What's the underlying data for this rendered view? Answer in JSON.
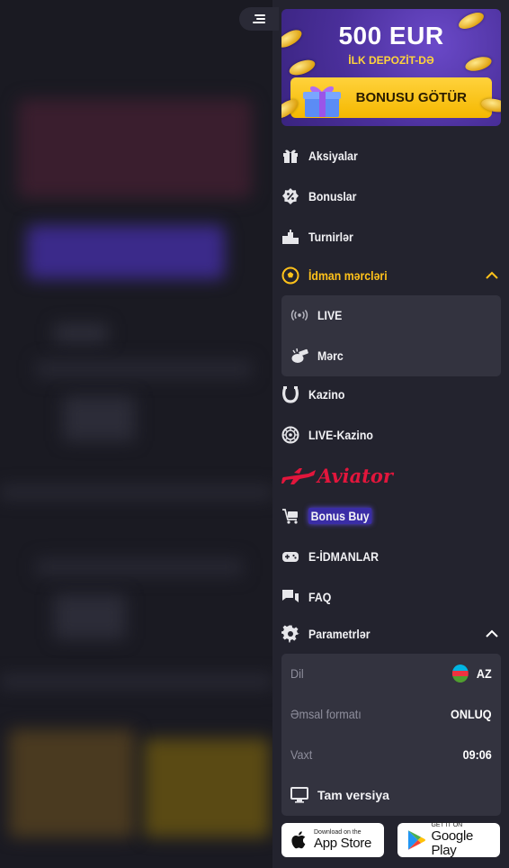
{
  "promo": {
    "amount": "500 EUR",
    "subtitle": "İLK DEPOZİT-DƏ",
    "button_label": "BONUSU GÖTÜR"
  },
  "menu": {
    "items": [
      {
        "label": "Aksiyalar",
        "icon": "gift-icon"
      },
      {
        "label": "Bonuslar",
        "icon": "percent-badge-icon"
      },
      {
        "label": "Turnirlər",
        "icon": "podium-icon"
      },
      {
        "label": "İdman mərcləri",
        "icon": "football-icon",
        "active": true,
        "expanded": true
      }
    ],
    "sport_sub": [
      {
        "label": "LIVE",
        "icon": "live-broadcast-icon"
      },
      {
        "label": "Mərc",
        "icon": "whistle-icon"
      }
    ],
    "items2": [
      {
        "label": "Kazino",
        "icon": "horseshoe-icon"
      },
      {
        "label": "LIVE-Kazino",
        "icon": "roulette-icon"
      }
    ],
    "aviator_label": "Aviator",
    "items3": [
      {
        "label": "Bonus Buy",
        "icon": "cart-icon"
      },
      {
        "label": "E-İDMANLAR",
        "icon": "gamepad-icon"
      },
      {
        "label": "FAQ",
        "icon": "chat-icon"
      },
      {
        "label": "Parametrlər",
        "icon": "gear-icon",
        "expanded": true
      }
    ]
  },
  "settings": {
    "language_key": "Dil",
    "language_value": "AZ",
    "odds_key": "Əmsal formatı",
    "odds_value": "ONLUQ",
    "time_key": "Vaxt",
    "time_value": "09:06",
    "full_version_label": "Tam versiya"
  },
  "stores": {
    "apple_small": "Download on the",
    "apple_big": "App Store",
    "google_small": "GET IT ON",
    "google_big": "Google Play"
  },
  "colors": {
    "accent": "#ffc21a",
    "drawer_bg": "#23232e",
    "panel_bg": "#33333f",
    "aviator_red": "#e2163c"
  }
}
